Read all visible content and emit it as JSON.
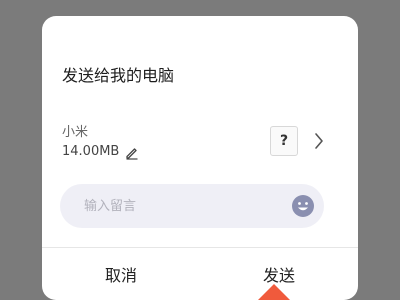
{
  "dialog": {
    "title": "发送给我的电脑",
    "file": {
      "name": "小米",
      "size": "14.00MB",
      "thumb_label": "?"
    },
    "message": {
      "placeholder": "输入留言"
    },
    "buttons": {
      "cancel": "取消",
      "send": "发送"
    }
  },
  "colors": {
    "backdrop": "#7b7b7b",
    "dialog_bg": "#ffffff",
    "input_bg": "#efeff6",
    "emoji": "#8a8fb0",
    "accent_pointer": "#f05a3c"
  },
  "icons": {
    "edit": "pencil-icon",
    "chevron": "chevron-right-icon",
    "emoji": "smiley-icon"
  }
}
